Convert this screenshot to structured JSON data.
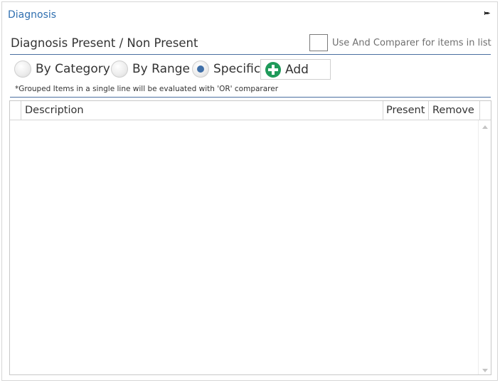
{
  "panel": {
    "title": "Diagnosis",
    "pin_icon": "pin-icon"
  },
  "section": {
    "title": "Diagnosis Present / Non Present",
    "and_comparer": {
      "checked": false,
      "label": "Use And Comparer for items in list"
    }
  },
  "mode": {
    "options": [
      {
        "label": "By Category",
        "selected": false
      },
      {
        "label": "By Range",
        "selected": false
      },
      {
        "label": "Specific",
        "selected": true
      }
    ],
    "add_label": "Add",
    "add_icon": "plus-circle-icon"
  },
  "note": "*Grouped Items in a single line will be evaluated with 'OR' compararer",
  "grid": {
    "columns": [
      "Description",
      "Present",
      "Remove"
    ],
    "rows": []
  },
  "colors": {
    "title_blue": "#2f6fb0",
    "separator": "#4a6fa0",
    "radio_selected": "#3f6fa8",
    "add_green": "#1f9a5a"
  }
}
